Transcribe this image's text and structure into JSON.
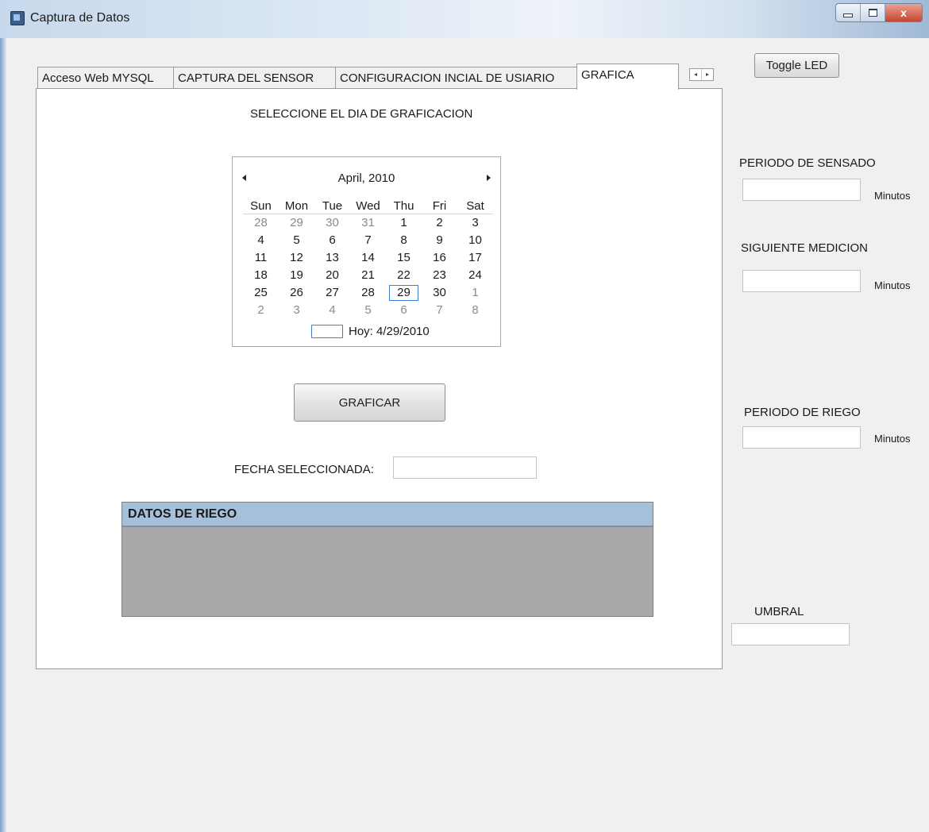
{
  "window": {
    "title": "Captura de Datos",
    "close_label": "x"
  },
  "tabs": [
    {
      "label": "Acceso Web MYSQL"
    },
    {
      "label": "CAPTURA DEL SENSOR"
    },
    {
      "label": "CONFIGURACION INCIAL DE USIARIO"
    },
    {
      "label": "GRAFICA"
    }
  ],
  "tab_scroll": {
    "left": "◂",
    "right": "▸"
  },
  "grafica": {
    "prompt": "SELECCIONE EL DIA DE GRAFICACION",
    "calendar": {
      "month_title": "April, 2010",
      "weekdays": [
        "Sun",
        "Mon",
        "Tue",
        "Wed",
        "Thu",
        "Fri",
        "Sat"
      ],
      "weeks": [
        [
          {
            "d": "28",
            "o": true
          },
          {
            "d": "29",
            "o": true
          },
          {
            "d": "30",
            "o": true
          },
          {
            "d": "31",
            "o": true
          },
          {
            "d": "1"
          },
          {
            "d": "2"
          },
          {
            "d": "3"
          }
        ],
        [
          {
            "d": "4"
          },
          {
            "d": "5"
          },
          {
            "d": "6"
          },
          {
            "d": "7"
          },
          {
            "d": "8"
          },
          {
            "d": "9"
          },
          {
            "d": "10"
          }
        ],
        [
          {
            "d": "11"
          },
          {
            "d": "12"
          },
          {
            "d": "13"
          },
          {
            "d": "14"
          },
          {
            "d": "15"
          },
          {
            "d": "16"
          },
          {
            "d": "17"
          }
        ],
        [
          {
            "d": "18"
          },
          {
            "d": "19"
          },
          {
            "d": "20"
          },
          {
            "d": "21"
          },
          {
            "d": "22"
          },
          {
            "d": "23"
          },
          {
            "d": "24"
          }
        ],
        [
          {
            "d": "25"
          },
          {
            "d": "26"
          },
          {
            "d": "27"
          },
          {
            "d": "28"
          },
          {
            "d": "29",
            "t": true
          },
          {
            "d": "30"
          },
          {
            "d": "1",
            "o": true
          }
        ],
        [
          {
            "d": "2",
            "o": true
          },
          {
            "d": "3",
            "o": true
          },
          {
            "d": "4",
            "o": true
          },
          {
            "d": "5",
            "o": true
          },
          {
            "d": "6",
            "o": true
          },
          {
            "d": "7",
            "o": true
          },
          {
            "d": "8",
            "o": true
          }
        ]
      ],
      "today_label": "Hoy: 4/29/2010"
    },
    "graficar_button": "GRAFICAR",
    "fecha_label": "FECHA SELECCIONADA:",
    "fecha_value": "",
    "grid_header": "DATOS DE RIEGO"
  },
  "side": {
    "toggle_button": "Toggle LED",
    "periodo_sensado_label": "PERIODO DE SENSADO",
    "periodo_sensado_unit": "Minutos",
    "siguiente_medicion_label": "SIGUIENTE MEDICION",
    "siguiente_medicion_unit": "Minutos",
    "periodo_riego_label": "PERIODO DE RIEGO",
    "periodo_riego_unit": "Minutos",
    "umbral_label": "UMBRAL"
  },
  "colors": {
    "grid_header": "#a6c0dc",
    "grid_body": "#a8a8a8",
    "today_outline": "#3a7fd1"
  }
}
